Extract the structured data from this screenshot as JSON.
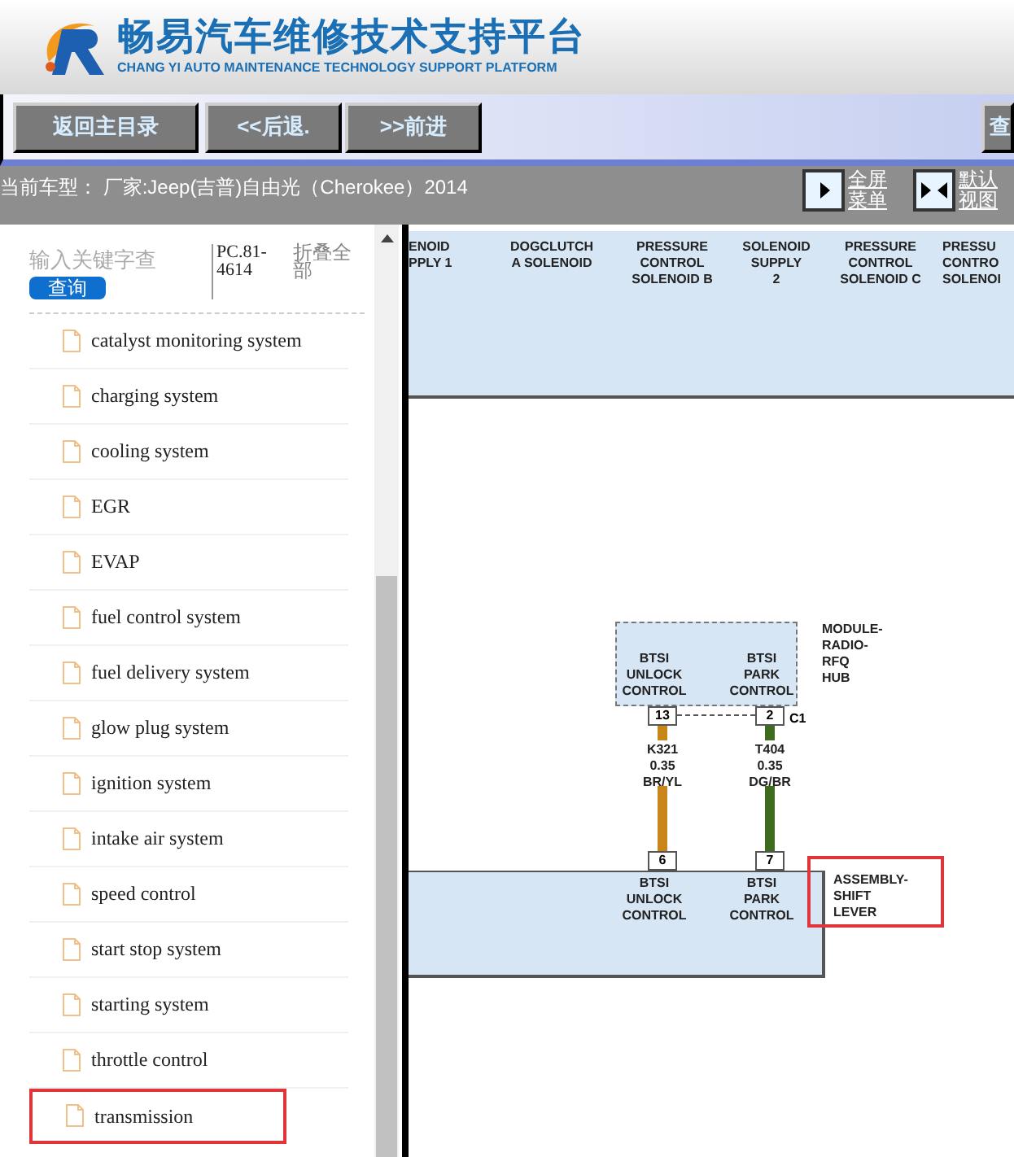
{
  "header": {
    "title": "畅易汽车维修技术支持平台",
    "subtitle": "CHANG YI AUTO MAINTENANCE TECHNOLOGY SUPPORT PLATFORM"
  },
  "nav": {
    "buttons": [
      "返回主目录",
      "<<后退.",
      ">>前进",
      "查"
    ]
  },
  "vehicle_bar": {
    "vehicle": "当前车型： 厂家:Jeep(吉普)自由光（Cherokee）2014",
    "actions": [
      {
        "kind": "fullscreen",
        "label": "全屏菜单"
      },
      {
        "kind": "default",
        "label": "默认视图"
      }
    ]
  },
  "sidebar": {
    "search": {
      "placeholder": "输入关键字查",
      "button": "查询"
    },
    "code": "PC.81-4614",
    "collapse_all": "折叠全部",
    "items": [
      {
        "label": "catalyst monitoring system",
        "selected": false
      },
      {
        "label": "charging system",
        "selected": false
      },
      {
        "label": "cooling system",
        "selected": false
      },
      {
        "label": "EGR",
        "selected": false
      },
      {
        "label": "EVAP",
        "selected": false
      },
      {
        "label": "fuel control system",
        "selected": false
      },
      {
        "label": "fuel delivery system",
        "selected": false
      },
      {
        "label": "glow plug system",
        "selected": false
      },
      {
        "label": "ignition system",
        "selected": false
      },
      {
        "label": "intake air system",
        "selected": false
      },
      {
        "label": "speed control",
        "selected": false
      },
      {
        "label": "start stop system",
        "selected": false
      },
      {
        "label": "starting system",
        "selected": false
      },
      {
        "label": "throttle control",
        "selected": false
      },
      {
        "label": "transmission",
        "selected": true
      }
    ]
  },
  "diagram": {
    "top_component_pins": [
      [
        "ENOID",
        "PPLY 1"
      ],
      [
        "DOGCLUTCH",
        "A SOLENOID"
      ],
      [
        "PRESSURE",
        "CONTROL",
        "SOLENOID B"
      ],
      [
        "SOLENOID",
        "SUPPLY",
        "2"
      ],
      [
        "PRESSURE",
        "CONTROL",
        "SOLENOID C"
      ],
      [
        "PRESSU",
        "CONTRO",
        "SOLENOI"
      ]
    ],
    "module": {
      "name": [
        "MODULE-",
        "RADIO-",
        "RFQ",
        "HUB"
      ],
      "connector": "C1",
      "pins": [
        {
          "function": [
            "BTSI",
            "UNLOCK",
            "CONTROL"
          ],
          "pin": "13"
        },
        {
          "function": [
            "BTSI",
            "PARK",
            "CONTROL"
          ],
          "pin": "2"
        }
      ]
    },
    "wires": [
      {
        "circuit": [
          "K321",
          "0.35",
          "BR/YL"
        ],
        "color": "#c8861a"
      },
      {
        "circuit": [
          "T404",
          "0.35",
          "DG/BR"
        ],
        "color": "#3f6b1f"
      }
    ],
    "shift_lever": {
      "name": [
        "ASSEMBLY-",
        "SHIFT",
        "LEVER"
      ],
      "highlighted": true,
      "pins": [
        {
          "function": [
            "BTSI",
            "UNLOCK",
            "CONTROL"
          ],
          "pin": "6"
        },
        {
          "function": [
            "BTSI",
            "PARK",
            "CONTROL"
          ],
          "pin": "7"
        }
      ]
    }
  }
}
